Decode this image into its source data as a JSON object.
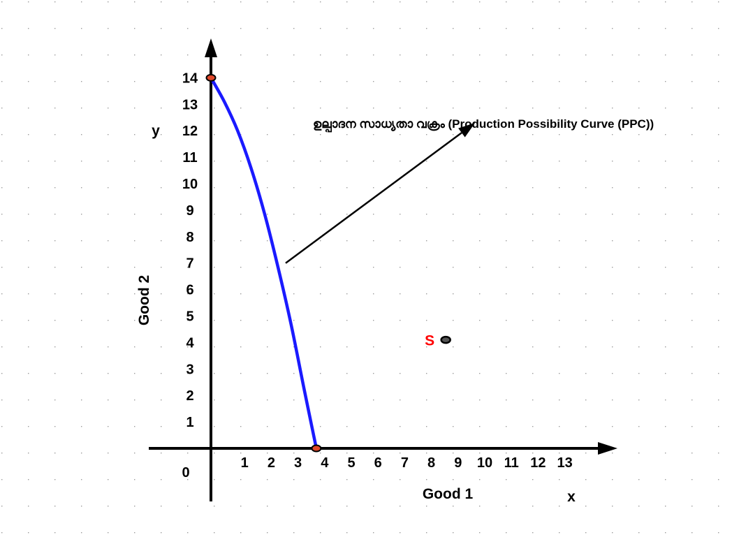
{
  "chart_data": {
    "type": "line",
    "title": "ഉല്പാദന സാധ്യതാ വക്രം (Production Possibility Curve (PPC))",
    "xlabel": "Good 1",
    "ylabel": "Good 2",
    "x_axis_letter": "x",
    "y_axis_letter": "y",
    "origin_label": "0",
    "x_ticks": [
      "1",
      "2",
      "3",
      "4",
      "5",
      "6",
      "7",
      "8",
      "9",
      "10",
      "11",
      "12",
      "13"
    ],
    "y_ticks": [
      "1",
      "2",
      "3",
      "4",
      "5",
      "6",
      "7",
      "8",
      "9",
      "10",
      "11",
      "12",
      "13",
      "14"
    ],
    "xlim": [
      0,
      15
    ],
    "ylim": [
      0,
      15
    ],
    "grid": "dotted",
    "series": [
      {
        "color": "#1a1aff",
        "x": [
          0,
          0.5,
          1,
          1.5,
          2,
          2.5,
          3,
          3.5,
          3.95
        ],
        "y": [
          14,
          13.1,
          12.0,
          10.6,
          8.9,
          6.9,
          4.7,
          2.2,
          0
        ]
      }
    ],
    "endpoints": [
      {
        "x": 0,
        "y": 14
      },
      {
        "x": 3.95,
        "y": 0
      }
    ],
    "points": [
      {
        "label": "S",
        "x": 8.8,
        "y": 4.1,
        "label_color": "#ff0000"
      }
    ],
    "annotation_arrow": {
      "from": [
        2.8,
        7.0
      ],
      "to": [
        9.9,
        12.3
      ]
    }
  }
}
